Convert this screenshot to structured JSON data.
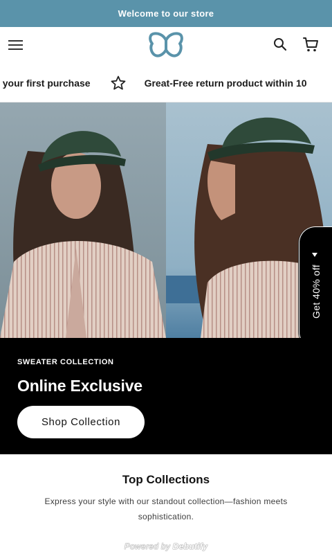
{
  "announcement": {
    "text": "Welcome to our store"
  },
  "header": {
    "menu_icon": "hamburger-menu-icon",
    "logo_icon": "butterfly-logo-icon",
    "search_icon": "search-icon",
    "cart_icon": "cart-icon"
  },
  "marquee": {
    "items": [
      "off your first purchase",
      "Great-Free return product within 10"
    ],
    "separator_icon": "star-icon"
  },
  "hero": {
    "image_description_icon": "hero-photo"
  },
  "side_tab": {
    "label": "Get 40% off",
    "caret_icon": "caret-up-icon"
  },
  "promo": {
    "eyebrow": "SWEATER COLLECTION",
    "heading": "Online Exclusive",
    "cta_label": "Shop Collection"
  },
  "collections": {
    "title": "Top Collections",
    "description": "Express your style with our standout collection—fashion meets sophistication."
  },
  "footer": {
    "powered_prefix": "Powered by",
    "powered_brand": "Debutify"
  },
  "colors": {
    "announcement_bg": "#5a93aa",
    "logo": "#5a93aa",
    "promo_bg": "#000000",
    "cta_bg": "#ffffff"
  }
}
